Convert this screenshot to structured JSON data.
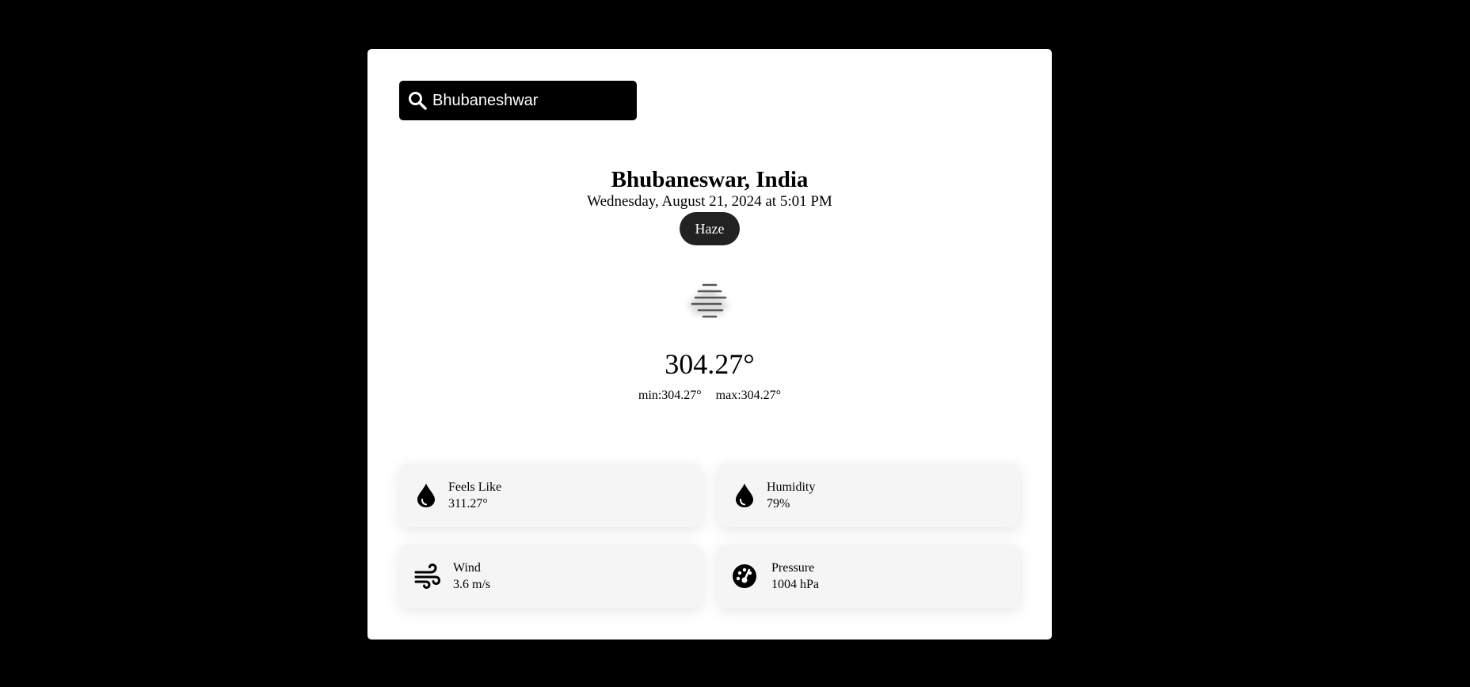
{
  "search": {
    "value": "Bhubaneshwar",
    "icon": "search-icon"
  },
  "location": {
    "title": "Bhubaneswar, India",
    "datetime": "Wednesday, August 21, 2024 at 5:01 PM",
    "condition": "Haze",
    "condition_icon": "haze-icon"
  },
  "temperature": {
    "current": "304.27°",
    "min": "min:304.27°",
    "max": "max:304.27°"
  },
  "stats": [
    {
      "label": "Feels Like",
      "value": "311.27°",
      "icon": "water-drop-icon"
    },
    {
      "label": "Humidity",
      "value": "79%",
      "icon": "water-drop-icon"
    },
    {
      "label": "Wind",
      "value": "3.6 m/s",
      "icon": "wind-icon"
    },
    {
      "label": "Pressure",
      "value": "1004 hPa",
      "icon": "gauge-icon"
    }
  ],
  "colors": {
    "background": "#000000",
    "card": "#ffffff",
    "badge": "#222222",
    "stat_card": "#f5f5f5"
  }
}
